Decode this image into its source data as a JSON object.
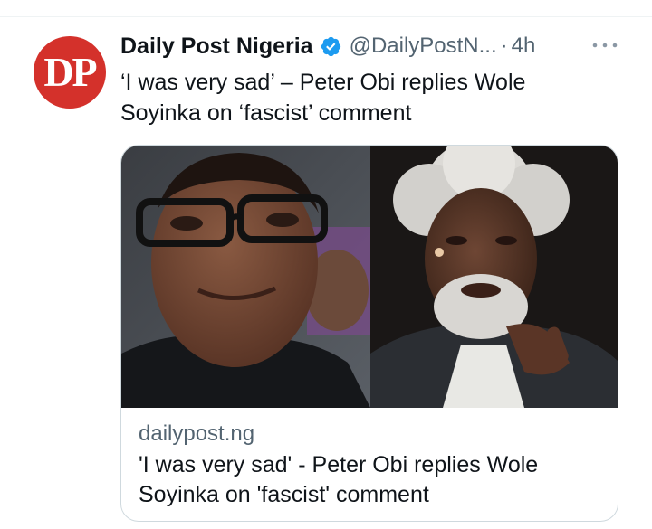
{
  "tweet": {
    "avatar_text": "DP",
    "author_name": "Daily Post Nigeria",
    "handle": "@DailyPostN...",
    "separator": "·",
    "time": "4h",
    "text": "‘I was very sad’ – Peter Obi replies Wole\nSoyinka on ‘fascist’ comment"
  },
  "card": {
    "domain": "dailypost.ng",
    "title": "'I was very sad' - Peter Obi replies Wole\nSoyinka on 'fascist' comment"
  },
  "colors": {
    "avatar_bg": "#d4312b",
    "verified_badge": "#1d9bf0",
    "secondary_text": "#536471",
    "card_border": "#cfd9de"
  },
  "icons": {
    "verified": "verified-badge-icon",
    "more": "more-horizontal-icon"
  }
}
